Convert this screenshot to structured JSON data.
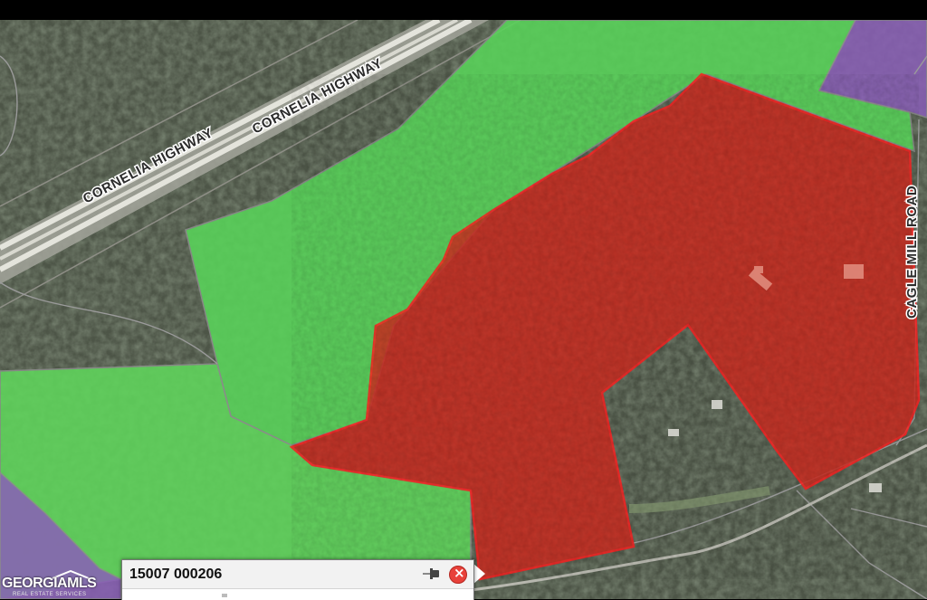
{
  "map": {
    "road_labels": [
      "CORNELIA HIGHWAY",
      "CORNELIA HIGHWAY",
      "CAGLE MILL ROAD"
    ],
    "colors": {
      "selected_parcel": "#cc2a1f",
      "selected_outline": "#ff2020",
      "green_parcel": "#59d45a",
      "purple_parcel": "#8a5fb8",
      "parcel_lines": "#8c8c8c"
    }
  },
  "popup": {
    "parcel_id": "15007 000206",
    "pin_icon": "pushpin-icon",
    "close_icon": "close-icon"
  },
  "logo": {
    "name": "GEORGIAMLS",
    "subtitle": "REAL ESTATE SERVICES"
  }
}
